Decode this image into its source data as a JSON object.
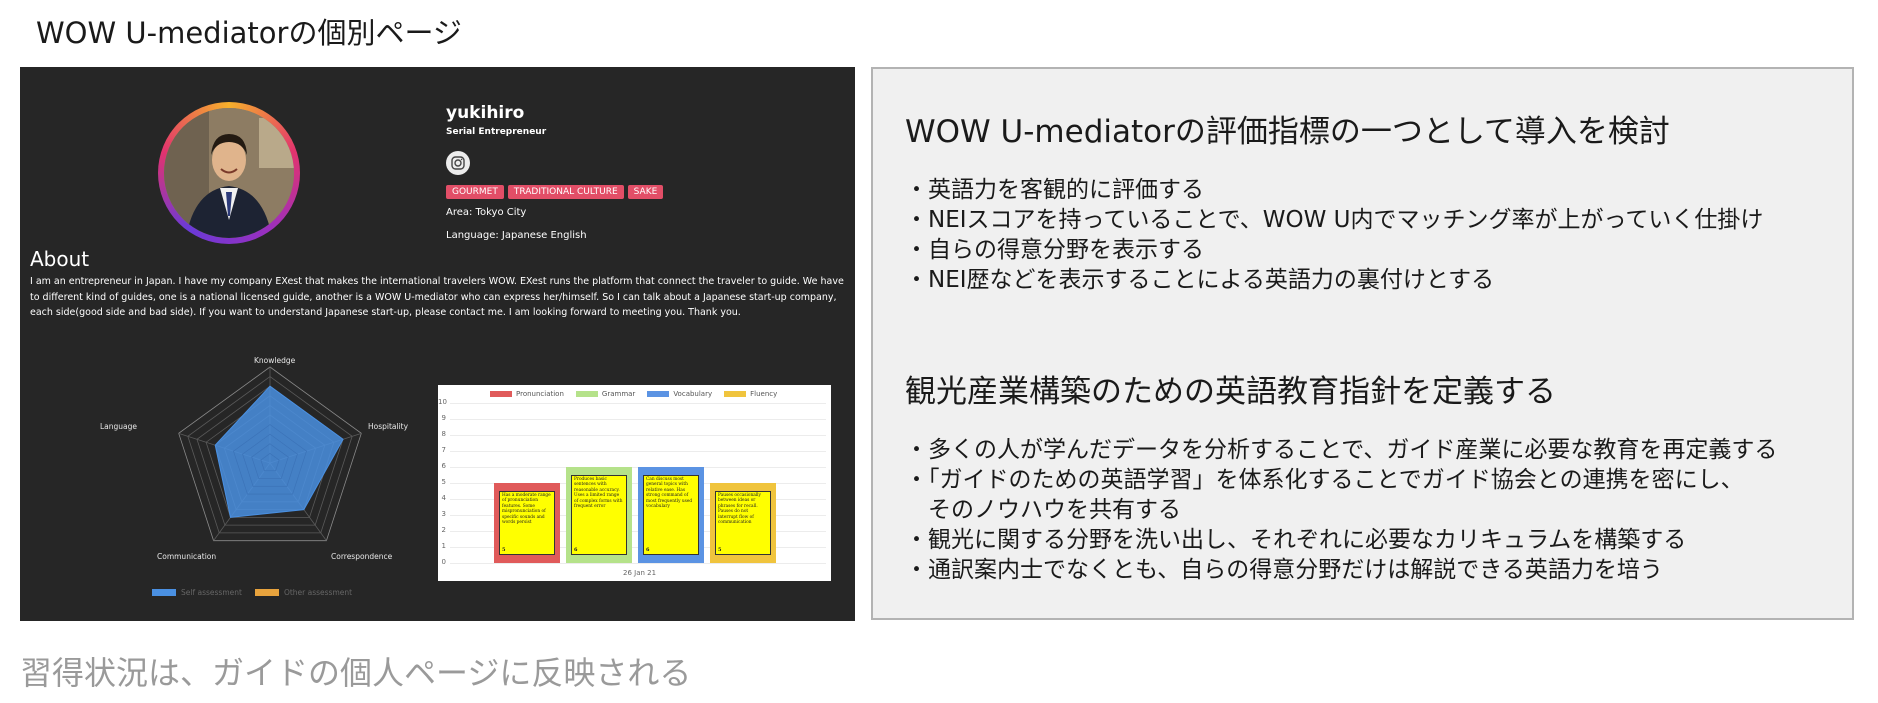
{
  "page_title": "WOW U-mediatorの個別ページ",
  "caption": "習得状況は、ガイドの個人ページに反映される",
  "profile": {
    "name": "yukihiro",
    "title": "Serial Entrepreneur",
    "tags": [
      "GOURMET",
      "TRADITIONAL CULTURE",
      "SAKE"
    ],
    "area": "Area: Tokyo City",
    "language": "Language: Japanese English",
    "about_heading": "About",
    "about_text": "I am an entrepreneur in Japan. I have my company EXest that makes the international travelers WOW. EXest runs the platform that connect the traveler to guide. We have to different kind of guides, one is a national licensed guide, another is a WOW U-mediator who can express her/himself. So I can talk about a Japanese start-up company, each side(good side and bad side). If you want to understand Japanese start-up, please contact me. I am looking forward to meeting you. Thank you."
  },
  "chart_data": [
    {
      "type": "radar",
      "axes": [
        "Knowledge",
        "Hospitality",
        "Correspondence",
        "Communication",
        "Language"
      ],
      "series": [
        {
          "name": "Self assessment",
          "values": [
            8,
            8,
            6,
            7,
            6
          ]
        },
        {
          "name": "Other assessment",
          "values": []
        }
      ],
      "rmax": 10,
      "colors": {
        "self": "#4a90e2",
        "other": "#e8a33d"
      }
    },
    {
      "type": "bar",
      "categories": [
        "26 Jan 21"
      ],
      "series": [
        {
          "name": "Pronunciation",
          "values": [
            5
          ],
          "color": "#e05a5a",
          "note": "Has a moderate range of pronunciation features. Some mispronunciation of specific sounds and words persist",
          "note_num": "5"
        },
        {
          "name": "Grammar",
          "values": [
            6
          ],
          "color": "#b5e28a",
          "note": "Produces basic sentences with reasonable accuracy. Uses a limited range of complex forms with frequent error",
          "note_num": "6"
        },
        {
          "name": "Vocabulary",
          "values": [
            6
          ],
          "color": "#5b93e3",
          "note": "Can discuss most general topics with relative ease. Has strong command of most frequently used vocabulary",
          "note_num": "6"
        },
        {
          "name": "Fluency",
          "values": [
            5
          ],
          "color": "#f0c43d",
          "note": "Pauses occasionally between ideas or phrases for recall. Pauses do not interrupt flow of communication",
          "note_num": "5"
        }
      ],
      "ylim": [
        0,
        10
      ],
      "yticks": [
        "0",
        "1",
        "2",
        "3",
        "4",
        "5",
        "6",
        "7",
        "8",
        "9",
        "10"
      ],
      "xlabel": "26 Jan 21"
    }
  ],
  "plan": {
    "heading1": "WOW U-mediatorの評価指標の一つとして導入を検討",
    "items1": [
      "・英語力を客観的に評価する",
      "・NEIスコアを持っていることで、WOW U内でマッチング率が上がっていく仕掛け",
      "・自らの得意分野を表示する",
      "・NEI歴などを表示することによる英語力の裏付けとする"
    ],
    "heading2": "観光産業構築のための英語教育指針を定義する",
    "items2": [
      "・多くの人が学んだデータを分析することで、ガイド産業に必要な教育を再定義する",
      "・「ガイドのための英語学習」を体系化することでガイド協会との連携を密にし、",
      "　そのノウハウを共有する",
      "・観光に関する分野を洗い出し、それぞれに必要なカリキュラムを構築する",
      "・通訳案内士でなくとも、自らの得意分野だけは解説できる英語力を培う"
    ]
  }
}
